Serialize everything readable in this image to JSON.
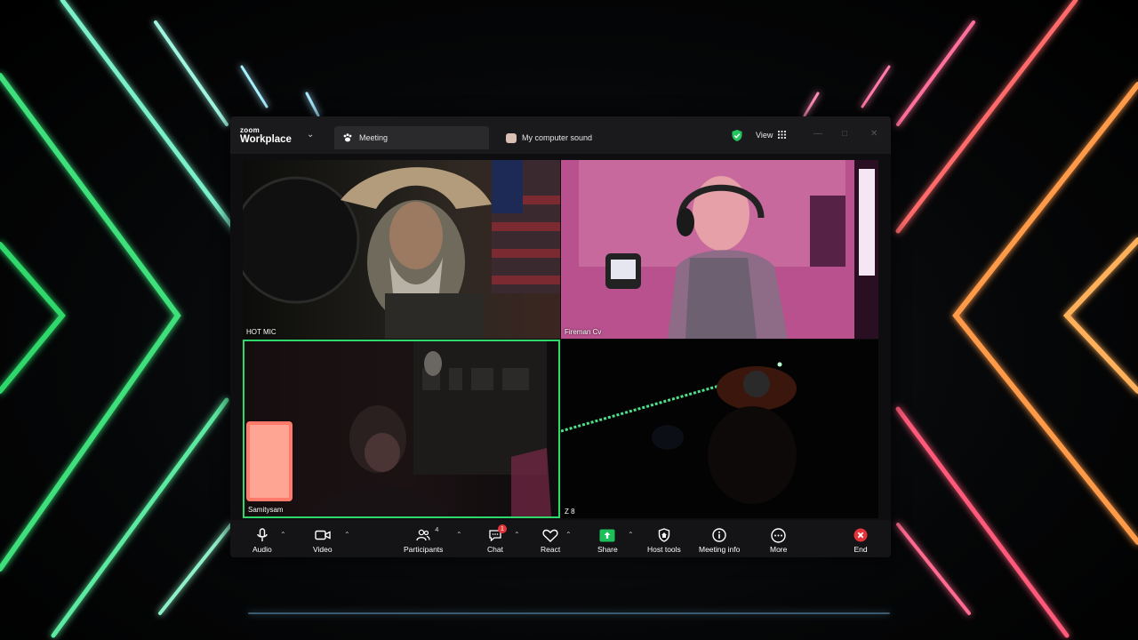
{
  "window": {
    "brand_small": "zoom",
    "brand_large": "Workplace"
  },
  "tabs": [
    {
      "label": "Meeting",
      "icon": "paw-icon"
    },
    {
      "label": "My computer sound",
      "icon": "sound-share-icon"
    }
  ],
  "header": {
    "view_label": "View",
    "security_icon": "shield-check-icon",
    "accent_green": "#2fd86a"
  },
  "participants": [
    {
      "name": "HOT MIC"
    },
    {
      "name": "Fireman Cv"
    },
    {
      "name": "Samitysam",
      "active_speaker": true
    },
    {
      "name": "Z 8"
    }
  ],
  "toolbar": {
    "audio_label": "Audio",
    "video_label": "Video",
    "participants_label": "Participants",
    "participants_count": "4",
    "chat_label": "Chat",
    "chat_badge": "1",
    "react_label": "React",
    "share_label": "Share",
    "host_tools_label": "Host tools",
    "meeting_info_label": "Meeting info",
    "more_label": "More",
    "end_label": "End",
    "share_color": "#1dbf5a",
    "end_color": "#e3343a"
  }
}
